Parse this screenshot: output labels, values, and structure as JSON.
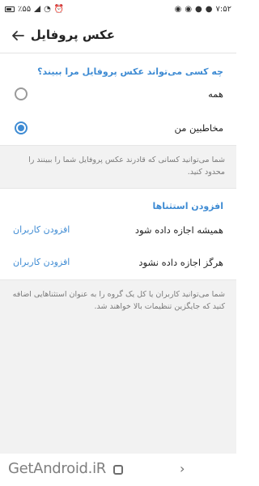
{
  "status_bar": {
    "left_text": "۷:۵۲",
    "right_text": "٪۵۵"
  },
  "appbar": {
    "title": "عکس پروفایل",
    "back_icon": "arrow-left-icon"
  },
  "privacy_section": {
    "title": "چه کسی می‌تواند عکس پروفایل مرا ببیند؟",
    "options": [
      {
        "label": "همه",
        "selected": false
      },
      {
        "label": "مخاطبین من",
        "selected": true
      }
    ],
    "info": "شما می‌توانید کسانی که قادرند عکس پروفایل شما را ببینند را محدود کنید."
  },
  "exceptions_section": {
    "title": "افزودن استثناها",
    "rows": [
      {
        "label": "همیشه اجازه داده شود",
        "action": "افزودن کاربران"
      },
      {
        "label": "هرگز اجازه داده نشود",
        "action": "افزودن کاربران"
      }
    ],
    "info": "شما می‌توانید کاربران یا کل یک گروه را به عنوان استثناهایی اضافه کنید که جایگزین تنظیمات بالا خواهند شد."
  },
  "watermark": "GetAndroid.iR",
  "colors": {
    "accent": "#3e8bd3",
    "text": "#222222",
    "muted": "#7b7b7b",
    "info_bg": "#f2f2f2"
  }
}
